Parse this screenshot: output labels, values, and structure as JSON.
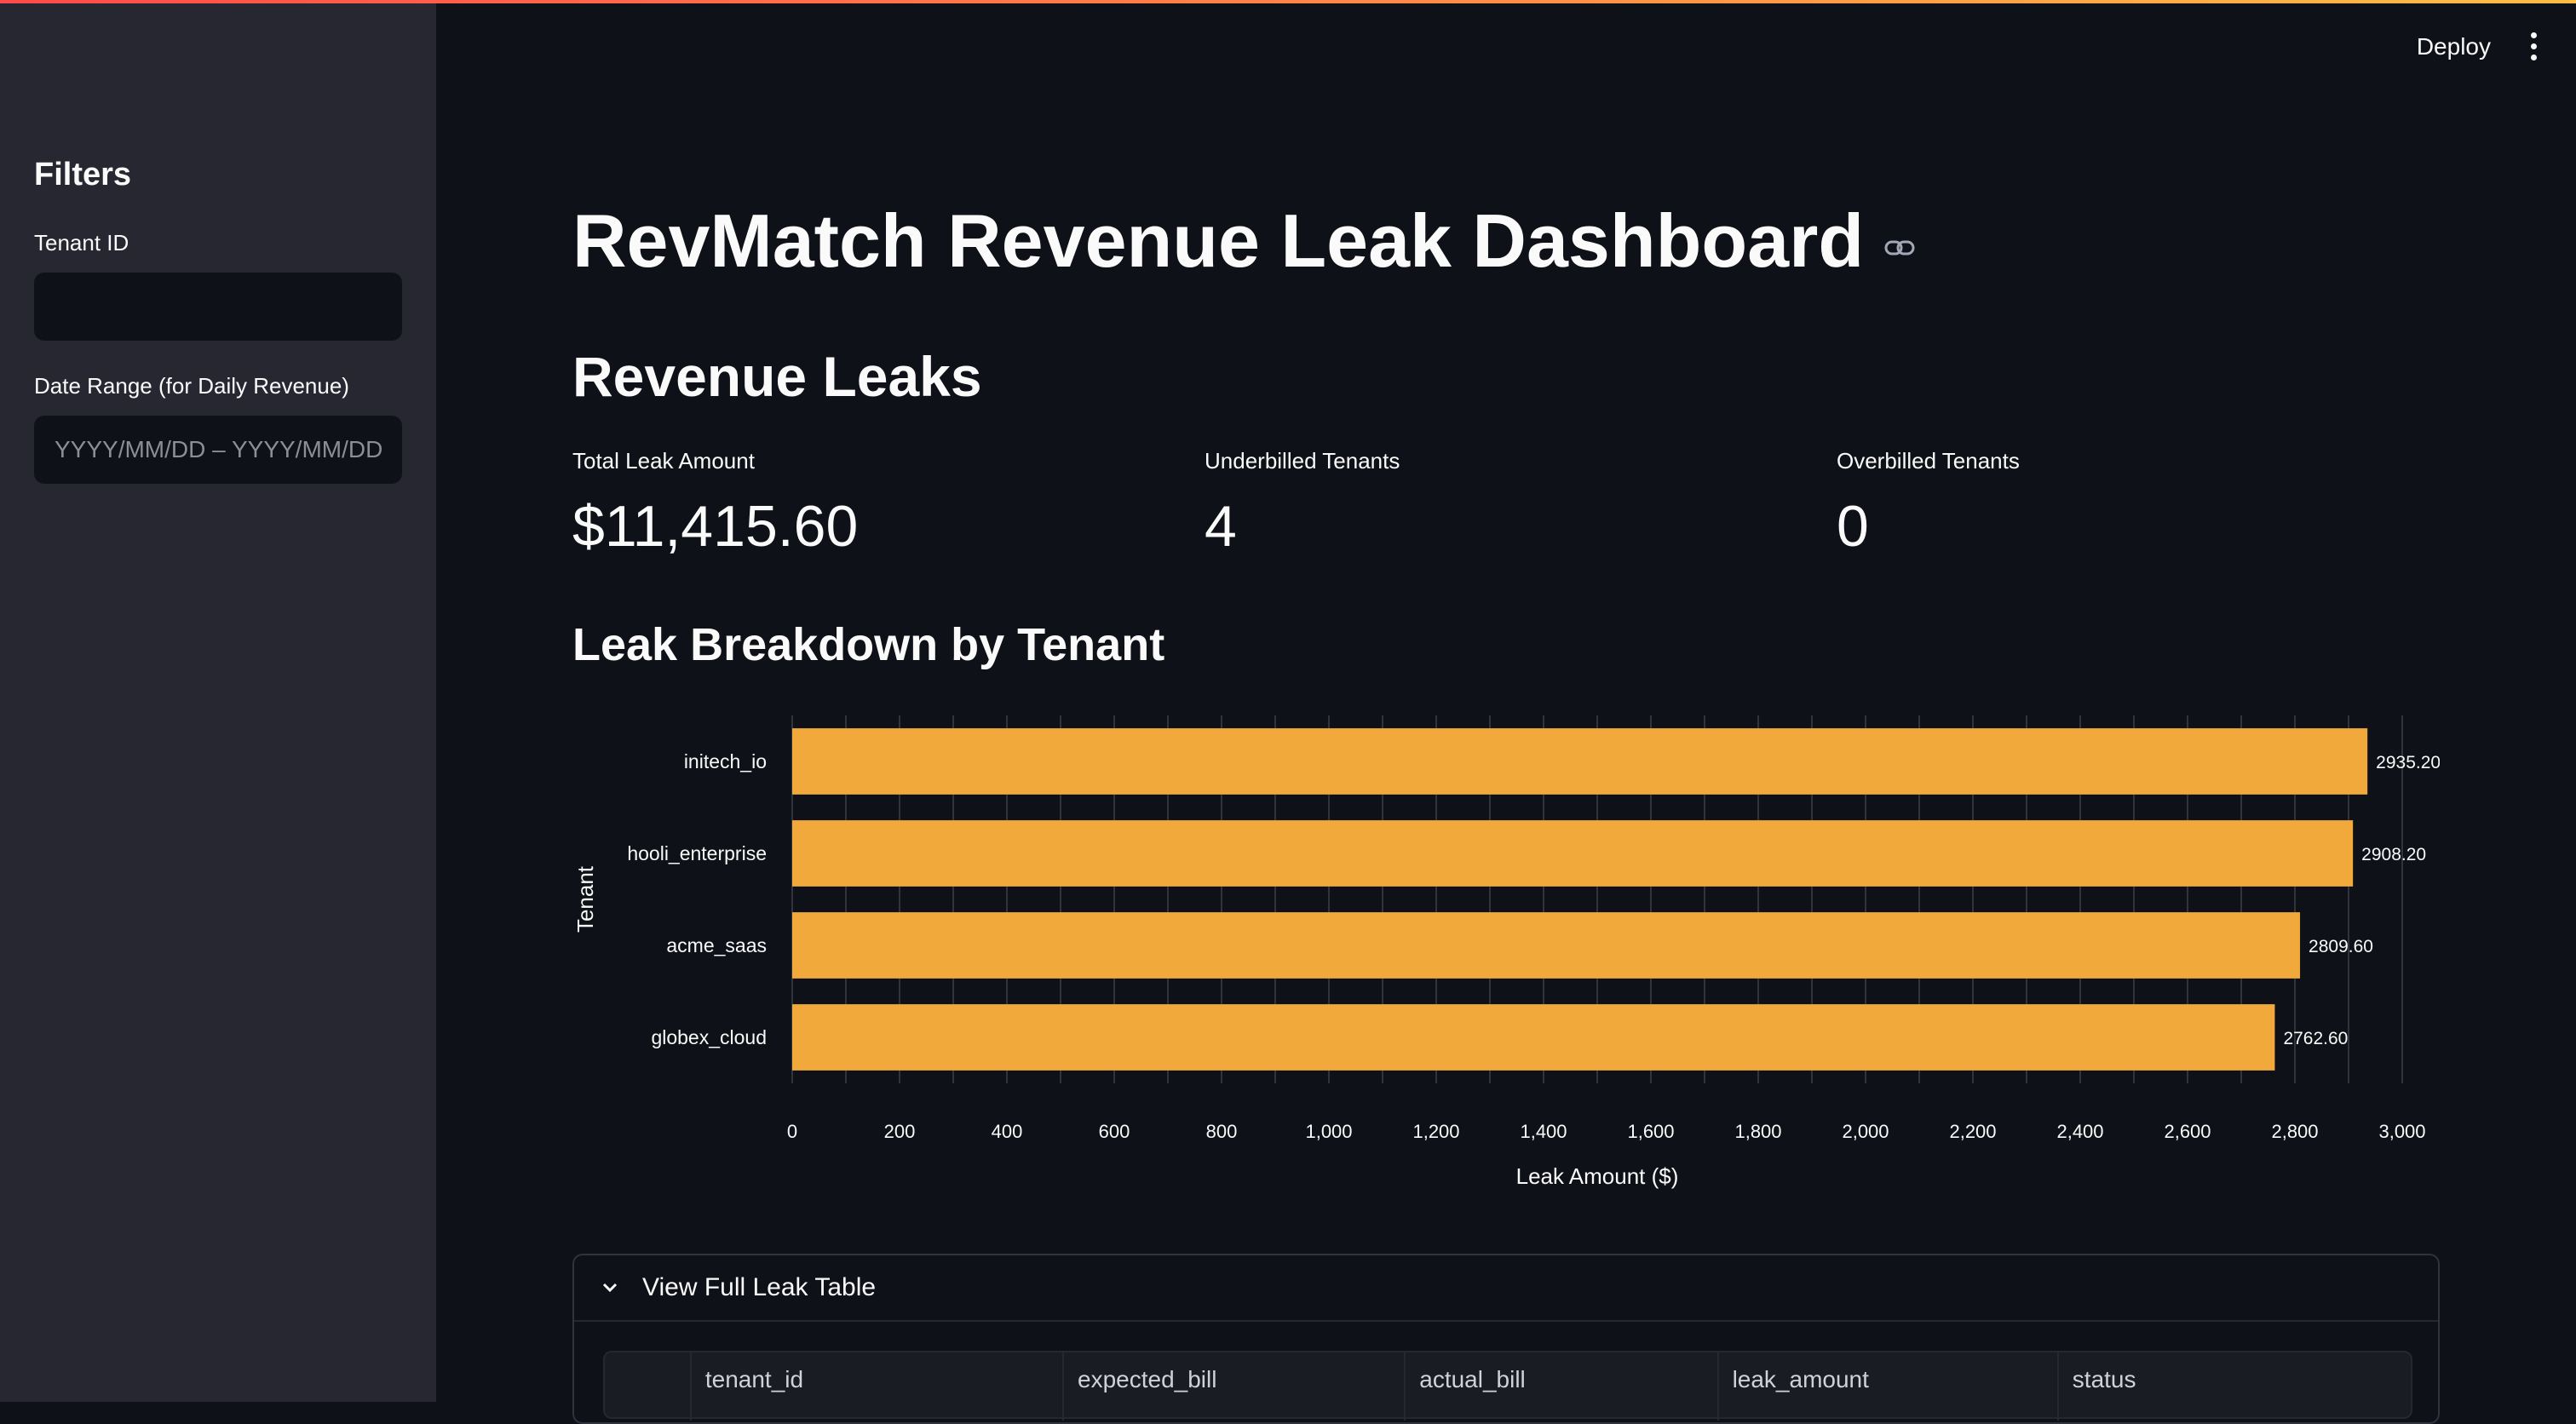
{
  "sidebar": {
    "title": "Filters",
    "tenant_label": "Tenant ID",
    "tenant_value": "",
    "date_label": "Date Range (for Daily Revenue)",
    "date_placeholder": "YYYY/MM/DD – YYYY/MM/DD"
  },
  "header": {
    "deploy_label": "Deploy",
    "menu_icon": "vertical-ellipsis-icon"
  },
  "page": {
    "title": "RevMatch Revenue Leak Dashboard",
    "section_title": "Revenue Leaks",
    "chart_title": "Leak Breakdown by Tenant"
  },
  "metrics": [
    {
      "label": "Total Leak Amount",
      "value": "$11,415.60"
    },
    {
      "label": "Underbilled Tenants",
      "value": "4"
    },
    {
      "label": "Overbilled Tenants",
      "value": "0"
    }
  ],
  "chart_data": {
    "type": "bar",
    "orientation": "horizontal",
    "categories": [
      "initech_io",
      "hooli_enterprise",
      "acme_saas",
      "globex_cloud"
    ],
    "values": [
      2935.2,
      2908.2,
      2809.6,
      2762.6
    ],
    "data_labels": [
      "2935.20",
      "2908.20",
      "2809.60",
      "2762.60"
    ],
    "xlabel": "Leak Amount ($)",
    "ylabel": "Tenant",
    "xlim": [
      0,
      3000
    ],
    "xticks": [
      0,
      200,
      400,
      600,
      800,
      1000,
      1200,
      1400,
      1600,
      1800,
      2000,
      2200,
      2400,
      2600,
      2800,
      3000
    ],
    "xtick_labels": [
      "0",
      "200",
      "400",
      "600",
      "800",
      "1,000",
      "1,200",
      "1,400",
      "1,600",
      "1,800",
      "2,000",
      "2,200",
      "2,400",
      "2,600",
      "2,800",
      "3,000"
    ],
    "bar_color": "#f2a93b",
    "grid": true
  },
  "expander": {
    "label": "View Full Leak Table",
    "columns": [
      "tenant_id",
      "expected_bill",
      "actual_bill",
      "leak_amount",
      "status"
    ]
  }
}
